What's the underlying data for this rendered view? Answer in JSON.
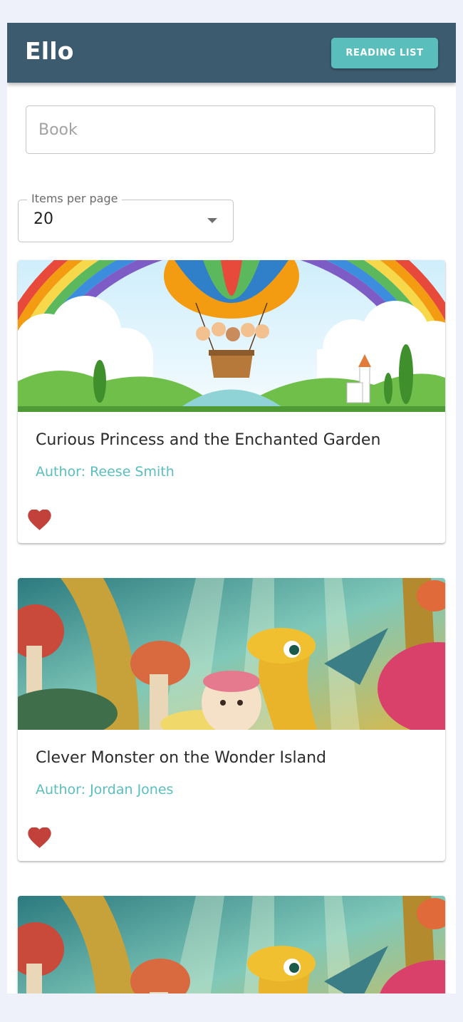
{
  "app": {
    "title": "Ello",
    "reading_list_label": "READING LIST"
  },
  "search": {
    "placeholder": "Book",
    "value": ""
  },
  "pagination": {
    "label": "Items per page",
    "value": "20"
  },
  "books": [
    {
      "title": "Curious Princess and the Enchanted Garden",
      "author": "Author: Reese Smith",
      "favorited": true
    },
    {
      "title": "Clever Monster on the Wonder Island",
      "author": "Author: Jordan Jones",
      "favorited": true
    },
    {
      "title": "",
      "author": "",
      "favorited": false
    }
  ],
  "colors": {
    "appbar": "#3c5b6f",
    "accent": "#5abfbc",
    "heart": "#c2413a",
    "background": "#eef1f9"
  }
}
